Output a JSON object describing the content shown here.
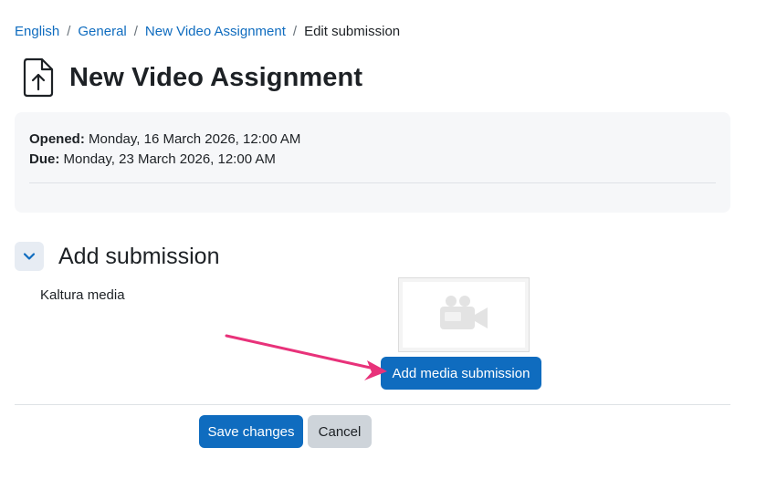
{
  "breadcrumb": {
    "items": [
      {
        "label": "English"
      },
      {
        "label": "General"
      },
      {
        "label": "New Video Assignment"
      }
    ],
    "separator": "/",
    "current": "Edit submission"
  },
  "page": {
    "title": "New Video Assignment",
    "icon": "assignment-upload-icon"
  },
  "dates": {
    "opened_label": "Opened:",
    "opened_value": " Monday, 16 March 2026, 12:00 AM",
    "due_label": "Due:",
    "due_value": " Monday, 23 March 2026, 12:00 AM"
  },
  "section": {
    "title": "Add submission",
    "collapse_icon": "chevron-down-icon"
  },
  "field": {
    "label": "Kaltura media",
    "preview_icon": "video-camera-icon",
    "button_label": "Add media submission"
  },
  "actions": {
    "save_label": "Save changes",
    "cancel_label": "Cancel"
  },
  "colors": {
    "primary": "#0f6cbf",
    "secondary": "#ced4da",
    "annotation_arrow": "#e8327a"
  }
}
